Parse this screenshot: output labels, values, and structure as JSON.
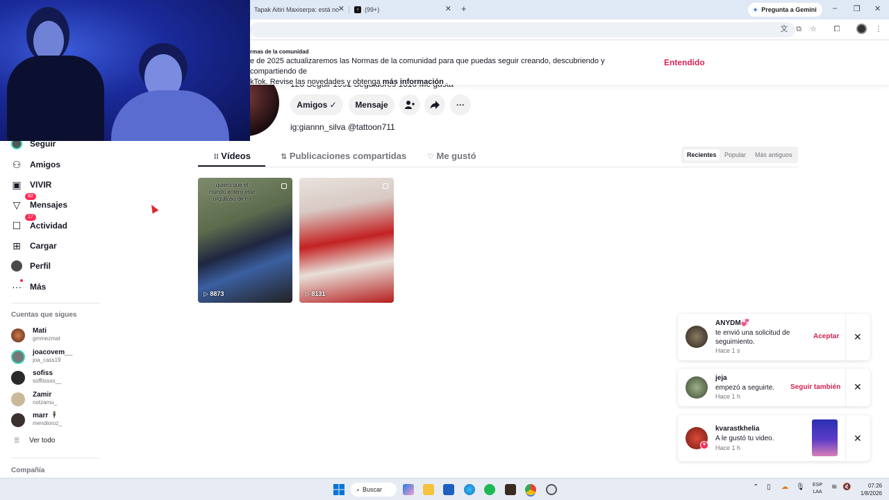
{
  "browser": {
    "tabs": [
      {
        "label": "Tapak Aitiri Maxiserpa: está no"
      },
      {
        "label": "(99+)"
      }
    ],
    "new_tab": "+",
    "gemini_label": "Pregunta a Gemini",
    "window_controls": {
      "minimize": "–",
      "maximize": "❐",
      "close": "✕"
    }
  },
  "banner": {
    "title": "rmas de la comunidad",
    "line1": "e de 2025 actualizaremos las Normas de la comunidad para que puedas seguir creando, descubriendo y compartiendo de",
    "line2_prefix": "kTok. Revise las novedades y obtenga",
    "line2_link": "más información",
    "line2_suffix": ".",
    "button": "Entendido"
  },
  "profile": {
    "stats_text": "126  Seguir    1991  Seguidores    1610  Me gusta",
    "buttons": {
      "friends": "Amigos ✓",
      "message": "Mensaje"
    },
    "bio": "ig:giannn_silva @tattoon711"
  },
  "content_tabs": [
    {
      "label": "Vídeos",
      "icon": "grid-icon"
    },
    {
      "label": "Publicaciones compartidas",
      "icon": "repost-icon"
    },
    {
      "label": "Me gustó",
      "icon": "heart-icon"
    }
  ],
  "sort_options": [
    "Recientes",
    "Popular",
    "Más antiguos"
  ],
  "videos": [
    {
      "caption": "quiero que el mundo entero este orgulloso de mi",
      "views": "8873"
    },
    {
      "caption": "",
      "views": "8131"
    }
  ],
  "sidebar": {
    "items": [
      {
        "label": "Seguir",
        "icon": "following-avatar-icon"
      },
      {
        "label": "Amigos",
        "icon": "friends-icon"
      },
      {
        "label": "VIVIR",
        "icon": "live-icon"
      },
      {
        "label": "Mensajes",
        "icon": "messages-icon",
        "badge": "82"
      },
      {
        "label": "Actividad",
        "icon": "activity-icon",
        "badge": "17"
      },
      {
        "label": "Cargar",
        "icon": "upload-icon"
      },
      {
        "label": "Perfil",
        "icon": "profile-avatar-icon"
      },
      {
        "label": "Más",
        "icon": "more-icon"
      }
    ],
    "following_title": "Cuentas que sigues",
    "following": [
      {
        "name": "Mati",
        "username": "gmmezmat"
      },
      {
        "name": "joacovem__",
        "username": "joa_cass19"
      },
      {
        "name": "sofiss",
        "username": "soffiissss__"
      },
      {
        "name": "Zamir",
        "username": "notzamu_"
      },
      {
        "name": "marr 🕴",
        "username": "mendioroz_"
      }
    ],
    "see_all": "Ver todo",
    "company": "Compañía"
  },
  "notifications": [
    {
      "name": "ANYDM💞",
      "text": "te envió una solicitud de seguimiento.",
      "time": "Hace 1 s",
      "action": "Aceptar"
    },
    {
      "name": "jeja",
      "text": "empezó a seguirte.",
      "time": "Hace 1 h",
      "action": "Seguir también"
    },
    {
      "name": "kvarastkhelia",
      "text": "A le gustó tu video.",
      "time": "Hace 1 h",
      "action": ""
    }
  ],
  "taskbar": {
    "search_label": "Buscar",
    "lang_line1": "ESP",
    "lang_line2": "LAA",
    "time": "07:26",
    "date": "1/8/2026"
  },
  "colors": {
    "accent": "#fe2c55",
    "link_red": "#d62151",
    "text": "#161823",
    "muted": "#73757b"
  }
}
